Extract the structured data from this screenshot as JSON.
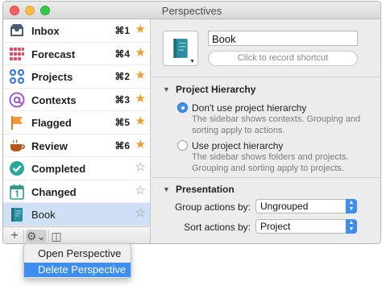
{
  "window": {
    "title": "Perspectives"
  },
  "sidebar": {
    "items": [
      {
        "label": "Inbox",
        "shortcut": "⌘1",
        "favorite": true,
        "icon": "inbox-icon"
      },
      {
        "label": "Forecast",
        "shortcut": "⌘4",
        "favorite": true,
        "icon": "forecast-icon"
      },
      {
        "label": "Projects",
        "shortcut": "⌘2",
        "favorite": true,
        "icon": "projects-icon"
      },
      {
        "label": "Contexts",
        "shortcut": "⌘3",
        "favorite": true,
        "icon": "contexts-icon"
      },
      {
        "label": "Flagged",
        "shortcut": "⌘5",
        "favorite": true,
        "icon": "flag-icon"
      },
      {
        "label": "Review",
        "shortcut": "⌘6",
        "favorite": true,
        "icon": "review-icon"
      },
      {
        "label": "Completed",
        "shortcut": "",
        "favorite": false,
        "icon": "completed-icon"
      },
      {
        "label": "Changed",
        "shortcut": "",
        "favorite": false,
        "icon": "changed-icon"
      },
      {
        "label": "Book",
        "shortcut": "",
        "favorite": false,
        "icon": "book-icon",
        "selected": true
      }
    ],
    "star_filled": "★",
    "star_empty": "☆"
  },
  "toolbar": {
    "add": "+",
    "gear": "⚙⌄",
    "panel": "◫"
  },
  "detail": {
    "name_value": "Book",
    "shortcut_placeholder": "Click to record shortcut",
    "hierarchy_section": "Project Hierarchy",
    "option_1": "Don't use project hierarchy",
    "option_1_desc": "The sidebar shows contexts. Grouping and sorting apply to actions.",
    "option_2": "Use project hierarchy",
    "option_2_desc": "The sidebar shows folders and projects. Grouping and sorting apply to projects.",
    "presentation_section": "Presentation",
    "group_label": "Group actions by:",
    "group_value": "Ungrouped",
    "sort_label": "Sort actions by:",
    "sort_value": "Project"
  },
  "context_menu": {
    "items": [
      "Open Perspective",
      "Delete Perspective"
    ],
    "highlighted": "Delete Perspective"
  },
  "colors": {
    "accent": "#3d8ef0",
    "selection": "#cfe0f6",
    "star": "#f39c2e"
  }
}
